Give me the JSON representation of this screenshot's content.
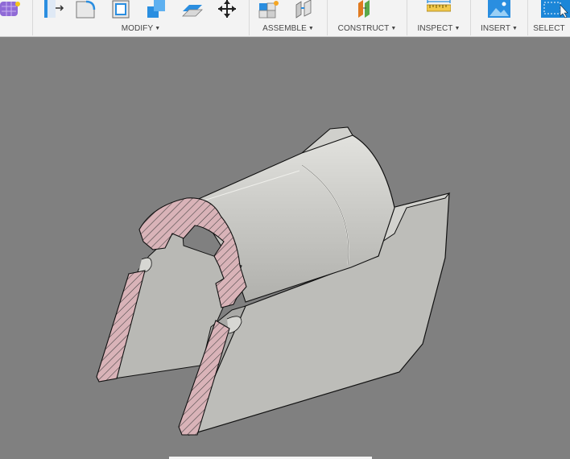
{
  "toolbar": {
    "groups": [
      {
        "id": "modify",
        "label": "MODIFY"
      },
      {
        "id": "assemble",
        "label": "ASSEMBLE"
      },
      {
        "id": "construct",
        "label": "CONSTRUCT"
      },
      {
        "id": "inspect",
        "label": "INSPECT"
      },
      {
        "id": "insert",
        "label": "INSERT"
      },
      {
        "id": "select",
        "label": "SELECT"
      }
    ],
    "icons": {
      "create": "form-cube-icon",
      "modify": [
        "press-pull-icon",
        "fillet-icon",
        "shell-icon",
        "combine-icon",
        "offset-face-icon",
        "move-icon"
      ],
      "assemble": [
        "new-component-icon",
        "joint-icon"
      ],
      "construct": "offset-plane-icon",
      "inspect": "measure-icon",
      "insert": "insert-image-icon",
      "select": "select-cursor-icon"
    },
    "colors": {
      "accent_blue": "#1e7fd6",
      "select_blue": "#1b86d8",
      "construct_orange": "#e07a1f",
      "construct_green": "#5aa84a"
    }
  },
  "viewport": {
    "background": "#808080",
    "model": {
      "body_color": "#c4c4c0",
      "section_hatch_color": "#d9b3b8"
    }
  }
}
